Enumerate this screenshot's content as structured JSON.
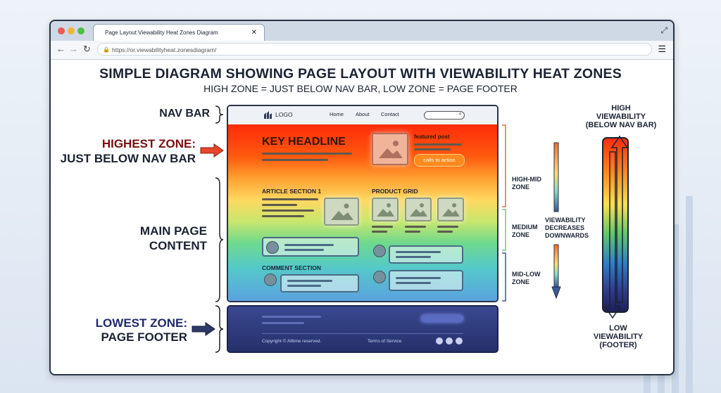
{
  "browser": {
    "tab_title": "Page Layout Viewability Heat Zones Diagram",
    "url": "https://or.viewabilityheat.zonesdiagram/"
  },
  "diagram": {
    "title": "SIMPLE DIAGRAM SHOWING PAGE LAYOUT WITH VIEWABILITY HEAT ZONES",
    "subtitle": "HIGH ZONE = JUST BELOW NAV BAR, LOW ZONE = PAGE FOOTER",
    "left_labels": {
      "nav_bar": "NAV BAR",
      "highest_zone_1": "HIGHEST ZONE:",
      "highest_zone_2": "JUST BELOW NAV BAR",
      "main_1": "MAIN PAGE",
      "main_2": "CONTENT",
      "lowest_1": "LOWEST ZONE:",
      "lowest_2": "PAGE FOOTER"
    },
    "mock_page": {
      "logo": "LOGO",
      "nav_links": [
        "Home",
        "About",
        "Contact"
      ],
      "headline": "KEY HEADLINE",
      "featured": "featured post",
      "cta": "calls to action",
      "article": "ARTICLE SECTION 1",
      "product": "PRODUCT GRID",
      "comment": "COMMENT SECTION",
      "copyright": "Copyright © Alltime reserved.",
      "terms": "Terms of Service"
    },
    "zones": {
      "high_mid": [
        "HIGH-MID",
        "ZONE"
      ],
      "medium": [
        "MEDIUM",
        "ZONE"
      ],
      "mid_low": [
        "MID-LOW",
        "ZONE"
      ]
    },
    "decrease_note": [
      "VIEWABILITY",
      "DECREASES",
      "DOWNWARDS"
    ],
    "scale": {
      "high": [
        "HIGH",
        "VIEWABILITY",
        "(BELOW NAV BAR)"
      ],
      "low": [
        "LOW",
        "VIEWABILITY",
        "(FOOTER)"
      ]
    }
  },
  "colors": {
    "heat_high": "#ff2b0a",
    "heat_low": "#5a9fe0",
    "footer": "#25306a",
    "highest_label": "#7a1010",
    "lowest_label": "#1f2a6b"
  }
}
